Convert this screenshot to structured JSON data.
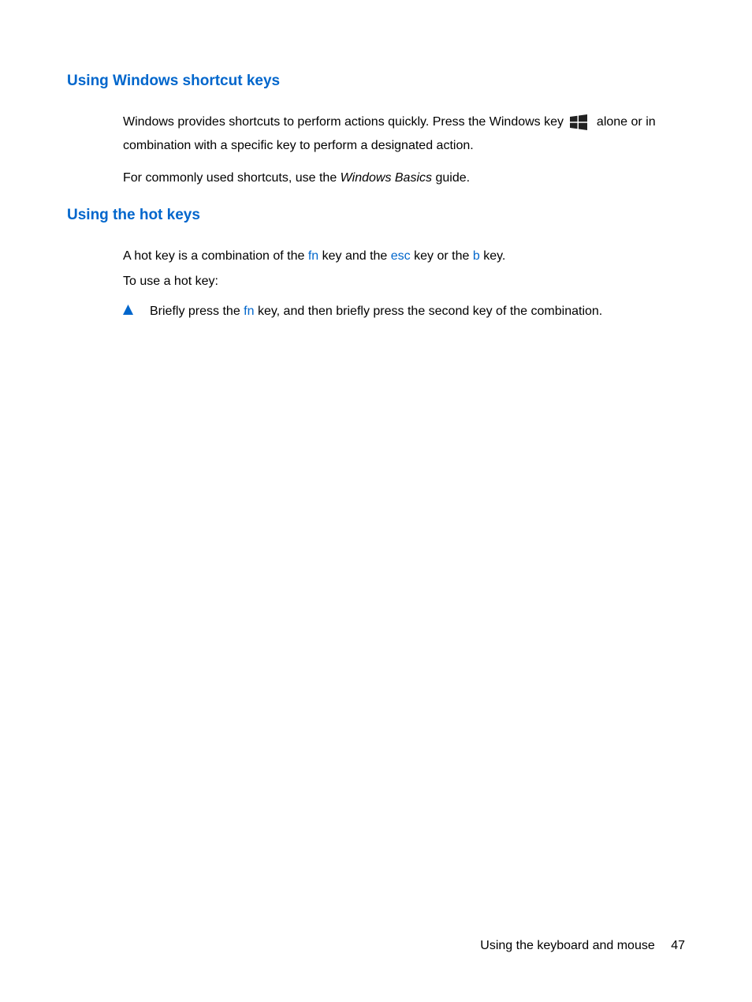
{
  "section1": {
    "heading": "Using Windows shortcut keys",
    "p1_a": "Windows provides shortcuts to perform actions quickly. Press the Windows key ",
    "p1_b": " alone or in combination with a specific key to perform a designated action.",
    "p2_a": "For commonly used shortcuts, use the ",
    "p2_italic": "Windows Basics",
    "p2_b": " guide."
  },
  "section2": {
    "heading": "Using the hot keys",
    "p1_a": "A hot key is a combination of the ",
    "p1_fn": "fn",
    "p1_b": " key and the ",
    "p1_esc": "esc",
    "p1_c": " key or the ",
    "p1_bkey": "b",
    "p1_d": " key.",
    "p2": "To use a hot key:",
    "bullet_a": "Briefly press the ",
    "bullet_fn": "fn",
    "bullet_b": " key, and then briefly press the second key of the combination."
  },
  "footer": {
    "text": "Using the keyboard and mouse",
    "page": "47"
  }
}
